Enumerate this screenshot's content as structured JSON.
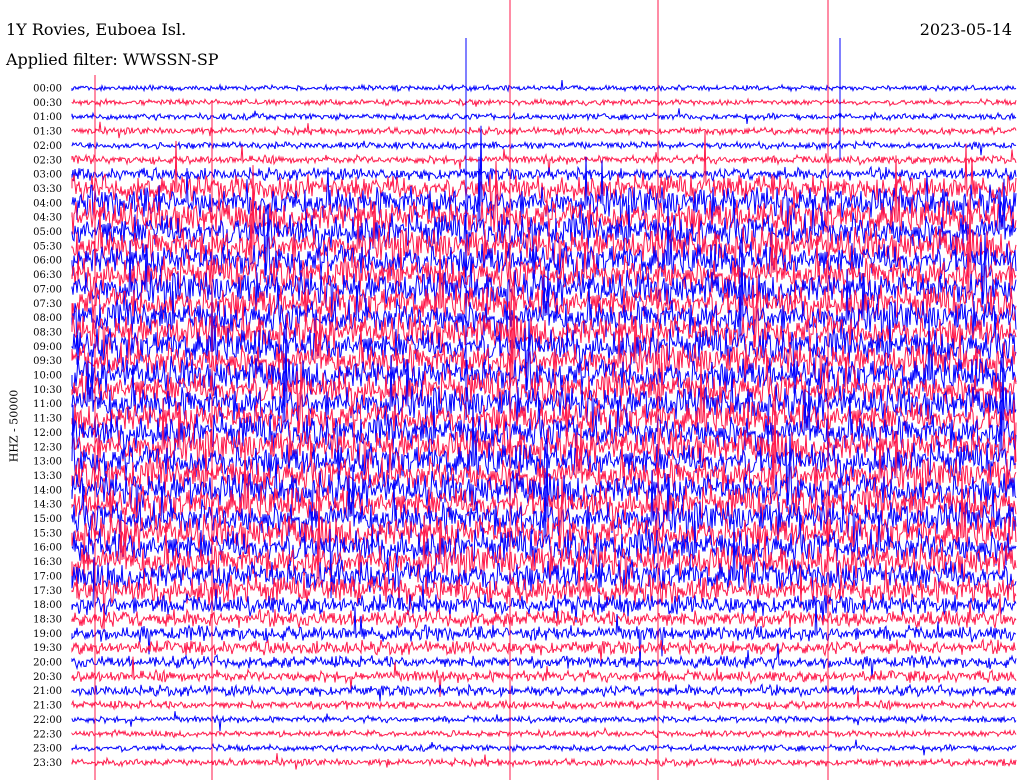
{
  "header": {
    "station": "1Y Rovies, Euboea Isl.",
    "date": "2023-05-14",
    "filter": "Applied filter: WWSSN-SP"
  },
  "colors": {
    "trace_a": "#0000ff",
    "trace_b": "#ff1a4b",
    "background": "#ffffff"
  },
  "chart_data": {
    "type": "line",
    "title": "1Y Rovies, Euboea Isl.",
    "subtitle": "Applied filter: WWSSN-SP",
    "date": "2023-05-14",
    "ylabel": "HHZ - 50000",
    "xlabel": "",
    "grid": false,
    "row_labels": [
      "00:00",
      "00:30",
      "01:00",
      "01:30",
      "02:00",
      "02:30",
      "03:00",
      "03:30",
      "04:00",
      "04:30",
      "05:00",
      "05:30",
      "06:00",
      "06:30",
      "07:00",
      "07:30",
      "08:00",
      "08:30",
      "09:00",
      "09:30",
      "10:00",
      "10:30",
      "11:00",
      "11:30",
      "12:00",
      "12:30",
      "13:00",
      "13:30",
      "14:00",
      "14:30",
      "15:00",
      "15:30",
      "16:00",
      "16:30",
      "17:00",
      "17:30",
      "18:00",
      "18:30",
      "19:00",
      "19:30",
      "20:00",
      "20:30",
      "21:00",
      "21:30",
      "22:00",
      "22:30",
      "23:00",
      "23:30"
    ],
    "series": [
      {
        "color": "#0000ff",
        "rows": "even"
      },
      {
        "color": "#ff1a4b",
        "rows": "odd"
      }
    ],
    "relative_amplitude": [
      0.08,
      0.1,
      0.12,
      0.14,
      0.14,
      0.18,
      0.3,
      0.75,
      0.95,
      1.0,
      1.0,
      1.0,
      1.0,
      1.0,
      1.0,
      1.0,
      1.0,
      1.0,
      1.0,
      1.0,
      1.0,
      1.0,
      1.0,
      1.0,
      1.0,
      1.0,
      1.0,
      1.0,
      1.0,
      1.0,
      1.0,
      1.0,
      1.0,
      0.95,
      0.9,
      0.8,
      0.55,
      0.45,
      0.4,
      0.35,
      0.3,
      0.28,
      0.25,
      0.18,
      0.12,
      0.12,
      0.12,
      0.14
    ]
  }
}
